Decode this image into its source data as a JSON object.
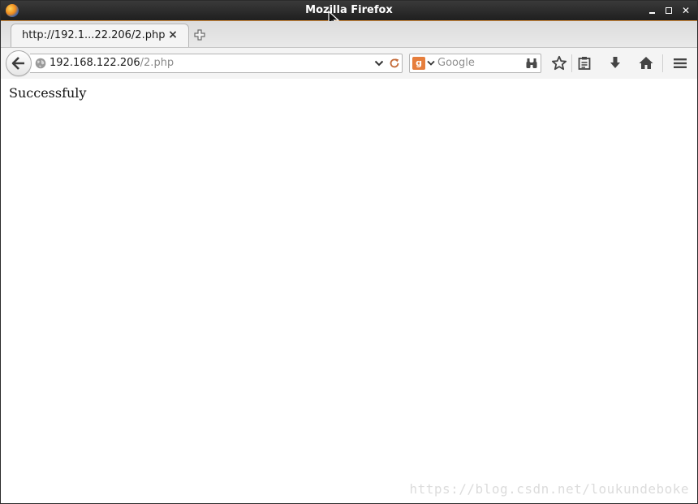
{
  "window": {
    "title": "Mozilla Firefox"
  },
  "tabs": [
    {
      "label": "http://192.1...22.206/2.php",
      "close": "×"
    }
  ],
  "urlbar": {
    "domain": "192.168.122.206",
    "path": "/2.php"
  },
  "search": {
    "engine": "Google",
    "engine_glyph": "g",
    "placeholder": "Google"
  },
  "icons": {
    "back": "back-arrow-icon",
    "globe": "globe-icon",
    "reload": "reload-icon",
    "bookmark": "star-icon",
    "reading_list": "reading-list-icon",
    "downloads": "download-arrow-icon",
    "home": "home-icon",
    "menu": "hamburger-menu-icon"
  },
  "page": {
    "message": "Successfuly"
  },
  "watermark": "https://blog.csdn.net/loukundeboke",
  "colors": {
    "titlebar": "#1f1f1f",
    "search_engine_accent": "#e67e3c"
  }
}
